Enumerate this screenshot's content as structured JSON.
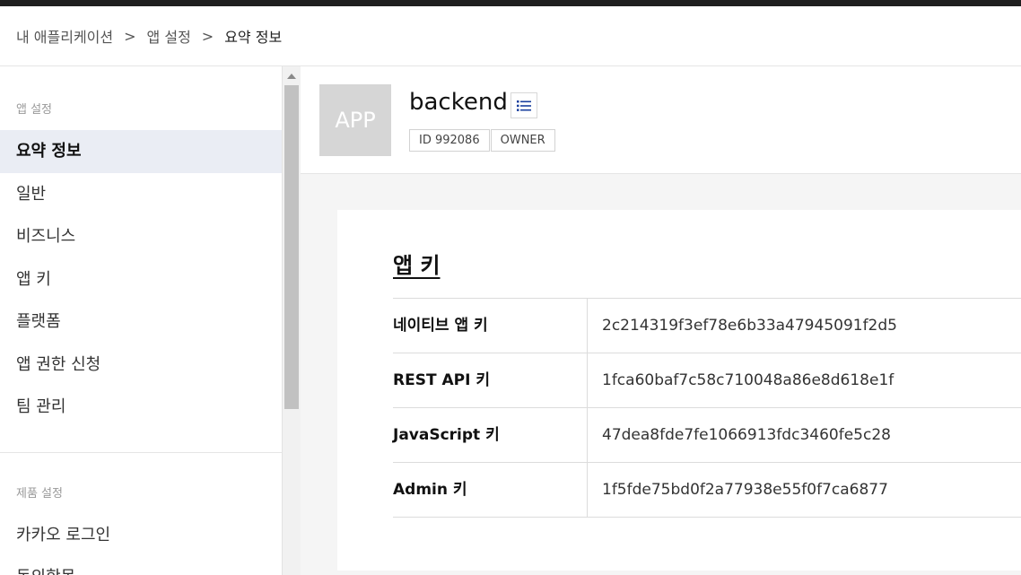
{
  "breadcrumb": {
    "items": [
      "내 애플리케이션",
      "앱 설정",
      "요약 정보"
    ],
    "separator": ">"
  },
  "sidebar": {
    "section1_title": "앱 설정",
    "items": [
      {
        "label": "요약 정보",
        "active": true
      },
      {
        "label": "일반"
      },
      {
        "label": "비즈니스"
      },
      {
        "label": "앱 키"
      },
      {
        "label": "플랫폼"
      },
      {
        "label": "앱 권한 신청"
      },
      {
        "label": "팀 관리"
      }
    ],
    "section2_title": "제품 설정",
    "section2_items": [
      {
        "label": "카카오 로그인"
      },
      {
        "label": "동의항목"
      }
    ]
  },
  "app": {
    "thumb_text": "APP",
    "name": "backend",
    "menu_icon": "list-icon",
    "tags": [
      "ID 992086",
      "OWNER"
    ]
  },
  "keys_card": {
    "title": "앱 키",
    "rows": [
      {
        "name": "네이티브 앱 키",
        "value": "2c214319f3ef78e6b33a47945091f2d5"
      },
      {
        "name": "REST API 키",
        "value": "1fca60baf7c58c710048a86e8d618e1f"
      },
      {
        "name": "JavaScript 키",
        "value": "47dea8fde7fe1066913fdc3460fe5c28"
      },
      {
        "name": "Admin 키",
        "value": "1f5fde75bd0f2a77938e55f0f7ca6877"
      }
    ]
  },
  "colors": {
    "topbar": "#1f1f1f",
    "active_item_bg": "#eaedf4",
    "menu_icon": "#1a3f9e",
    "thumb_bg": "#d6d6d6"
  }
}
